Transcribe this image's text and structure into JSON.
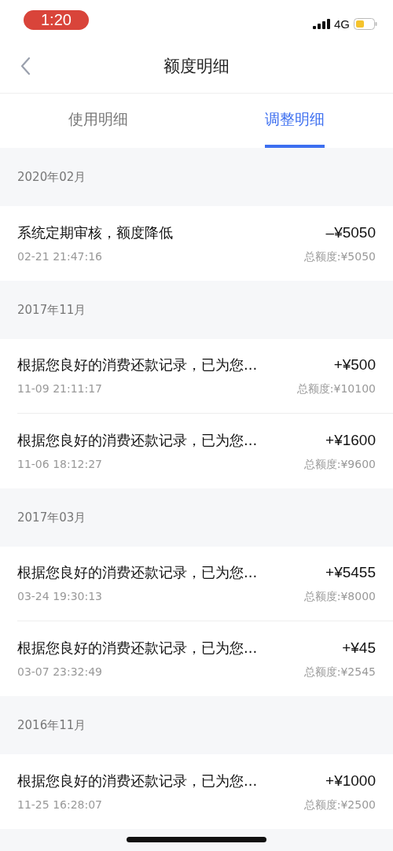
{
  "status_bar": {
    "time": "1:20",
    "network": "4G"
  },
  "nav": {
    "title": "额度明细"
  },
  "tabs": [
    {
      "label": "使用明细",
      "selected": false
    },
    {
      "label": "调整明细",
      "selected": true
    }
  ],
  "groups": [
    {
      "month": "2020年02月",
      "records": [
        {
          "title": "系统定期审核，额度降低",
          "time": "02-21 21:47:16",
          "amount": "–¥5050",
          "total": "总额度:¥5050"
        }
      ]
    },
    {
      "month": "2017年11月",
      "records": [
        {
          "title": "根据您良好的消费还款记录，已为您...",
          "time": "11-09 21:11:17",
          "amount": "+¥500",
          "total": "总额度:¥10100"
        },
        {
          "title": "根据您良好的消费还款记录，已为您...",
          "time": "11-06 18:12:27",
          "amount": "+¥1600",
          "total": "总额度:¥9600"
        }
      ]
    },
    {
      "month": "2017年03月",
      "records": [
        {
          "title": "根据您良好的消费还款记录，已为您...",
          "time": "03-24 19:30:13",
          "amount": "+¥5455",
          "total": "总额度:¥8000"
        },
        {
          "title": "根据您良好的消费还款记录，已为您...",
          "time": "03-07 23:32:49",
          "amount": "+¥45",
          "total": "总额度:¥2545"
        }
      ]
    },
    {
      "month": "2016年11月",
      "records": [
        {
          "title": "根据您良好的消费还款记录，已为您...",
          "time": "11-25 16:28:07",
          "amount": "+¥1000",
          "total": "总额度:¥2500"
        }
      ]
    }
  ]
}
